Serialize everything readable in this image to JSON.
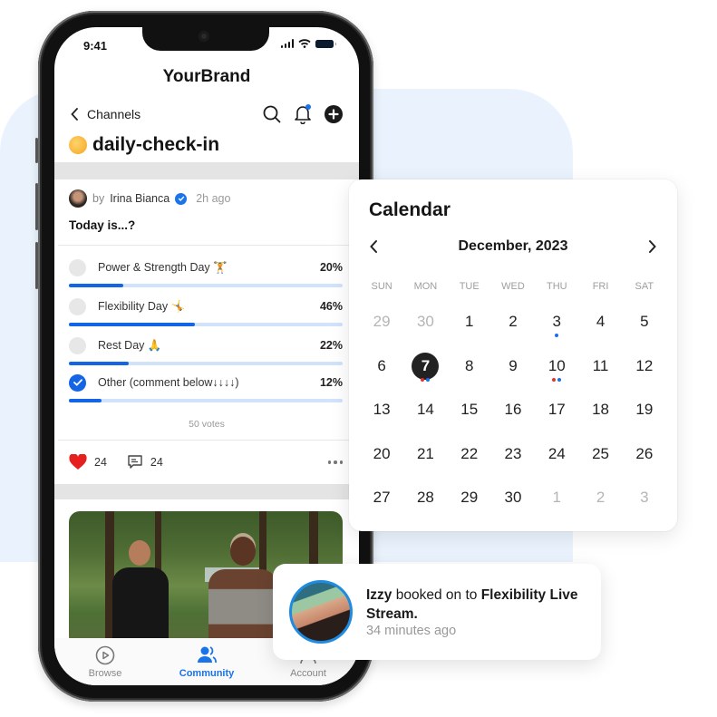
{
  "phone": {
    "status_bar": {
      "time": "9:41"
    },
    "brand": "YourBrand",
    "nav": {
      "back_label": "Channels"
    },
    "channel": {
      "emoji": "sun-emoji",
      "title": "daily-check-in"
    },
    "post": {
      "by_prefix": "by",
      "author": "Irina Bianca",
      "verified": true,
      "time_ago": "2h ago",
      "question": "Today is...?",
      "options": [
        {
          "label": "Power & Strength Day 🏋",
          "percent": "20%",
          "fraction": 0.2,
          "checked": false
        },
        {
          "label": "Flexibility Day 🤸",
          "percent": "46%",
          "fraction": 0.46,
          "checked": false
        },
        {
          "label": "Rest Day 🙏",
          "percent": "22%",
          "fraction": 0.22,
          "checked": false
        },
        {
          "label": "Other (comment below↓↓↓↓)",
          "percent": "12%",
          "fraction": 0.12,
          "checked": true
        }
      ],
      "votes": "50 votes",
      "likes": "24",
      "comments": "24"
    },
    "tabbar": {
      "tabs": [
        {
          "label": "Browse",
          "icon": "play-circle-icon",
          "active": false
        },
        {
          "label": "Community",
          "icon": "community-icon",
          "active": true
        },
        {
          "label": "Account",
          "icon": "account-icon",
          "active": false
        }
      ]
    }
  },
  "calendar": {
    "title": "Calendar",
    "month": "December, 2023",
    "weekdays": [
      "SUN",
      "MON",
      "TUE",
      "WED",
      "THU",
      "FRI",
      "SAT"
    ],
    "weeks": [
      [
        {
          "d": "29",
          "muted": true
        },
        {
          "d": "30",
          "muted": true
        },
        {
          "d": "1"
        },
        {
          "d": "2"
        },
        {
          "d": "3",
          "dots": [
            "blue"
          ]
        },
        {
          "d": "4"
        },
        {
          "d": "5"
        }
      ],
      [
        {
          "d": "6"
        },
        {
          "d": "7",
          "selected": true,
          "dots": [
            "red",
            "blue"
          ]
        },
        {
          "d": "8"
        },
        {
          "d": "9"
        },
        {
          "d": "10",
          "dots": [
            "red",
            "blue"
          ]
        },
        {
          "d": "11"
        },
        {
          "d": "12"
        }
      ],
      [
        {
          "d": "13"
        },
        {
          "d": "14"
        },
        {
          "d": "15"
        },
        {
          "d": "16"
        },
        {
          "d": "17"
        },
        {
          "d": "18"
        },
        {
          "d": "19"
        }
      ],
      [
        {
          "d": "20"
        },
        {
          "d": "21"
        },
        {
          "d": "22"
        },
        {
          "d": "23"
        },
        {
          "d": "24"
        },
        {
          "d": "25"
        },
        {
          "d": "26"
        }
      ],
      [
        {
          "d": "27"
        },
        {
          "d": "28"
        },
        {
          "d": "29"
        },
        {
          "d": "30"
        },
        {
          "d": "1",
          "muted": true
        },
        {
          "d": "2",
          "muted": true
        },
        {
          "d": "3",
          "muted": true
        }
      ]
    ],
    "dot_colors": {
      "red": "#e5322d",
      "blue": "#1a6ef0"
    }
  },
  "notification": {
    "name": "Izzy",
    "action": " booked on to ",
    "target": "Flexibility Live Stream.",
    "time": "34 minutes ago"
  },
  "colors": {
    "accent": "#1465e6",
    "bar_track": "#d0e3fb",
    "heart": "#e5201f",
    "background_blob": "#eaf3fd"
  }
}
